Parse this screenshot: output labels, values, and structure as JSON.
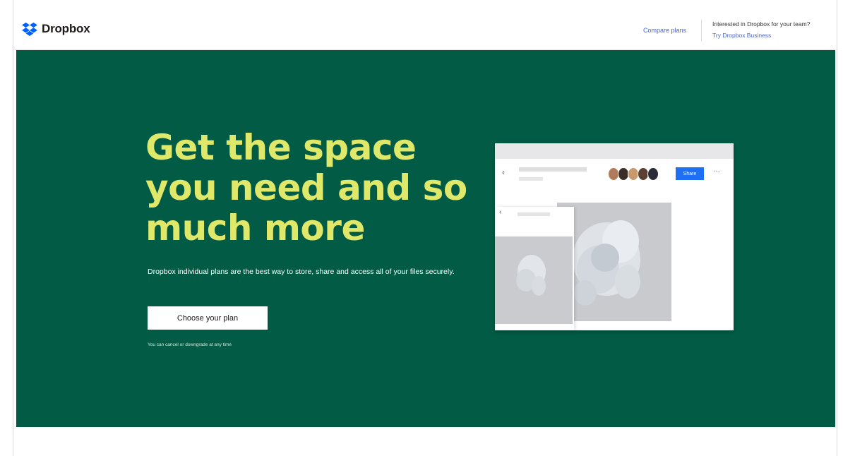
{
  "header": {
    "logo_text": "Dropbox",
    "compare_plans": "Compare plans",
    "promo_line1": "Interested in Dropbox for your team?",
    "promo_line2": "Try Dropbox Business"
  },
  "hero": {
    "headline": "Get the space you need and so much more",
    "subcopy": "Dropbox individual plans are the best way to store, share and access all of your files securely.",
    "cta_label": "Choose your plan",
    "fineprint": "You can cancel or downgrade at any time"
  },
  "mockup": {
    "share_label": "Share",
    "more_label": "···",
    "back_label": "‹"
  },
  "colors": {
    "hero_bg": "#025c45",
    "headline": "#e0e86a",
    "share_button": "#1e6ff4",
    "link": "#4a67c9"
  },
  "icons": {
    "logo": "dropbox-logo-icon",
    "back": "chevron-left-icon",
    "more": "more-horizontal-icon"
  }
}
